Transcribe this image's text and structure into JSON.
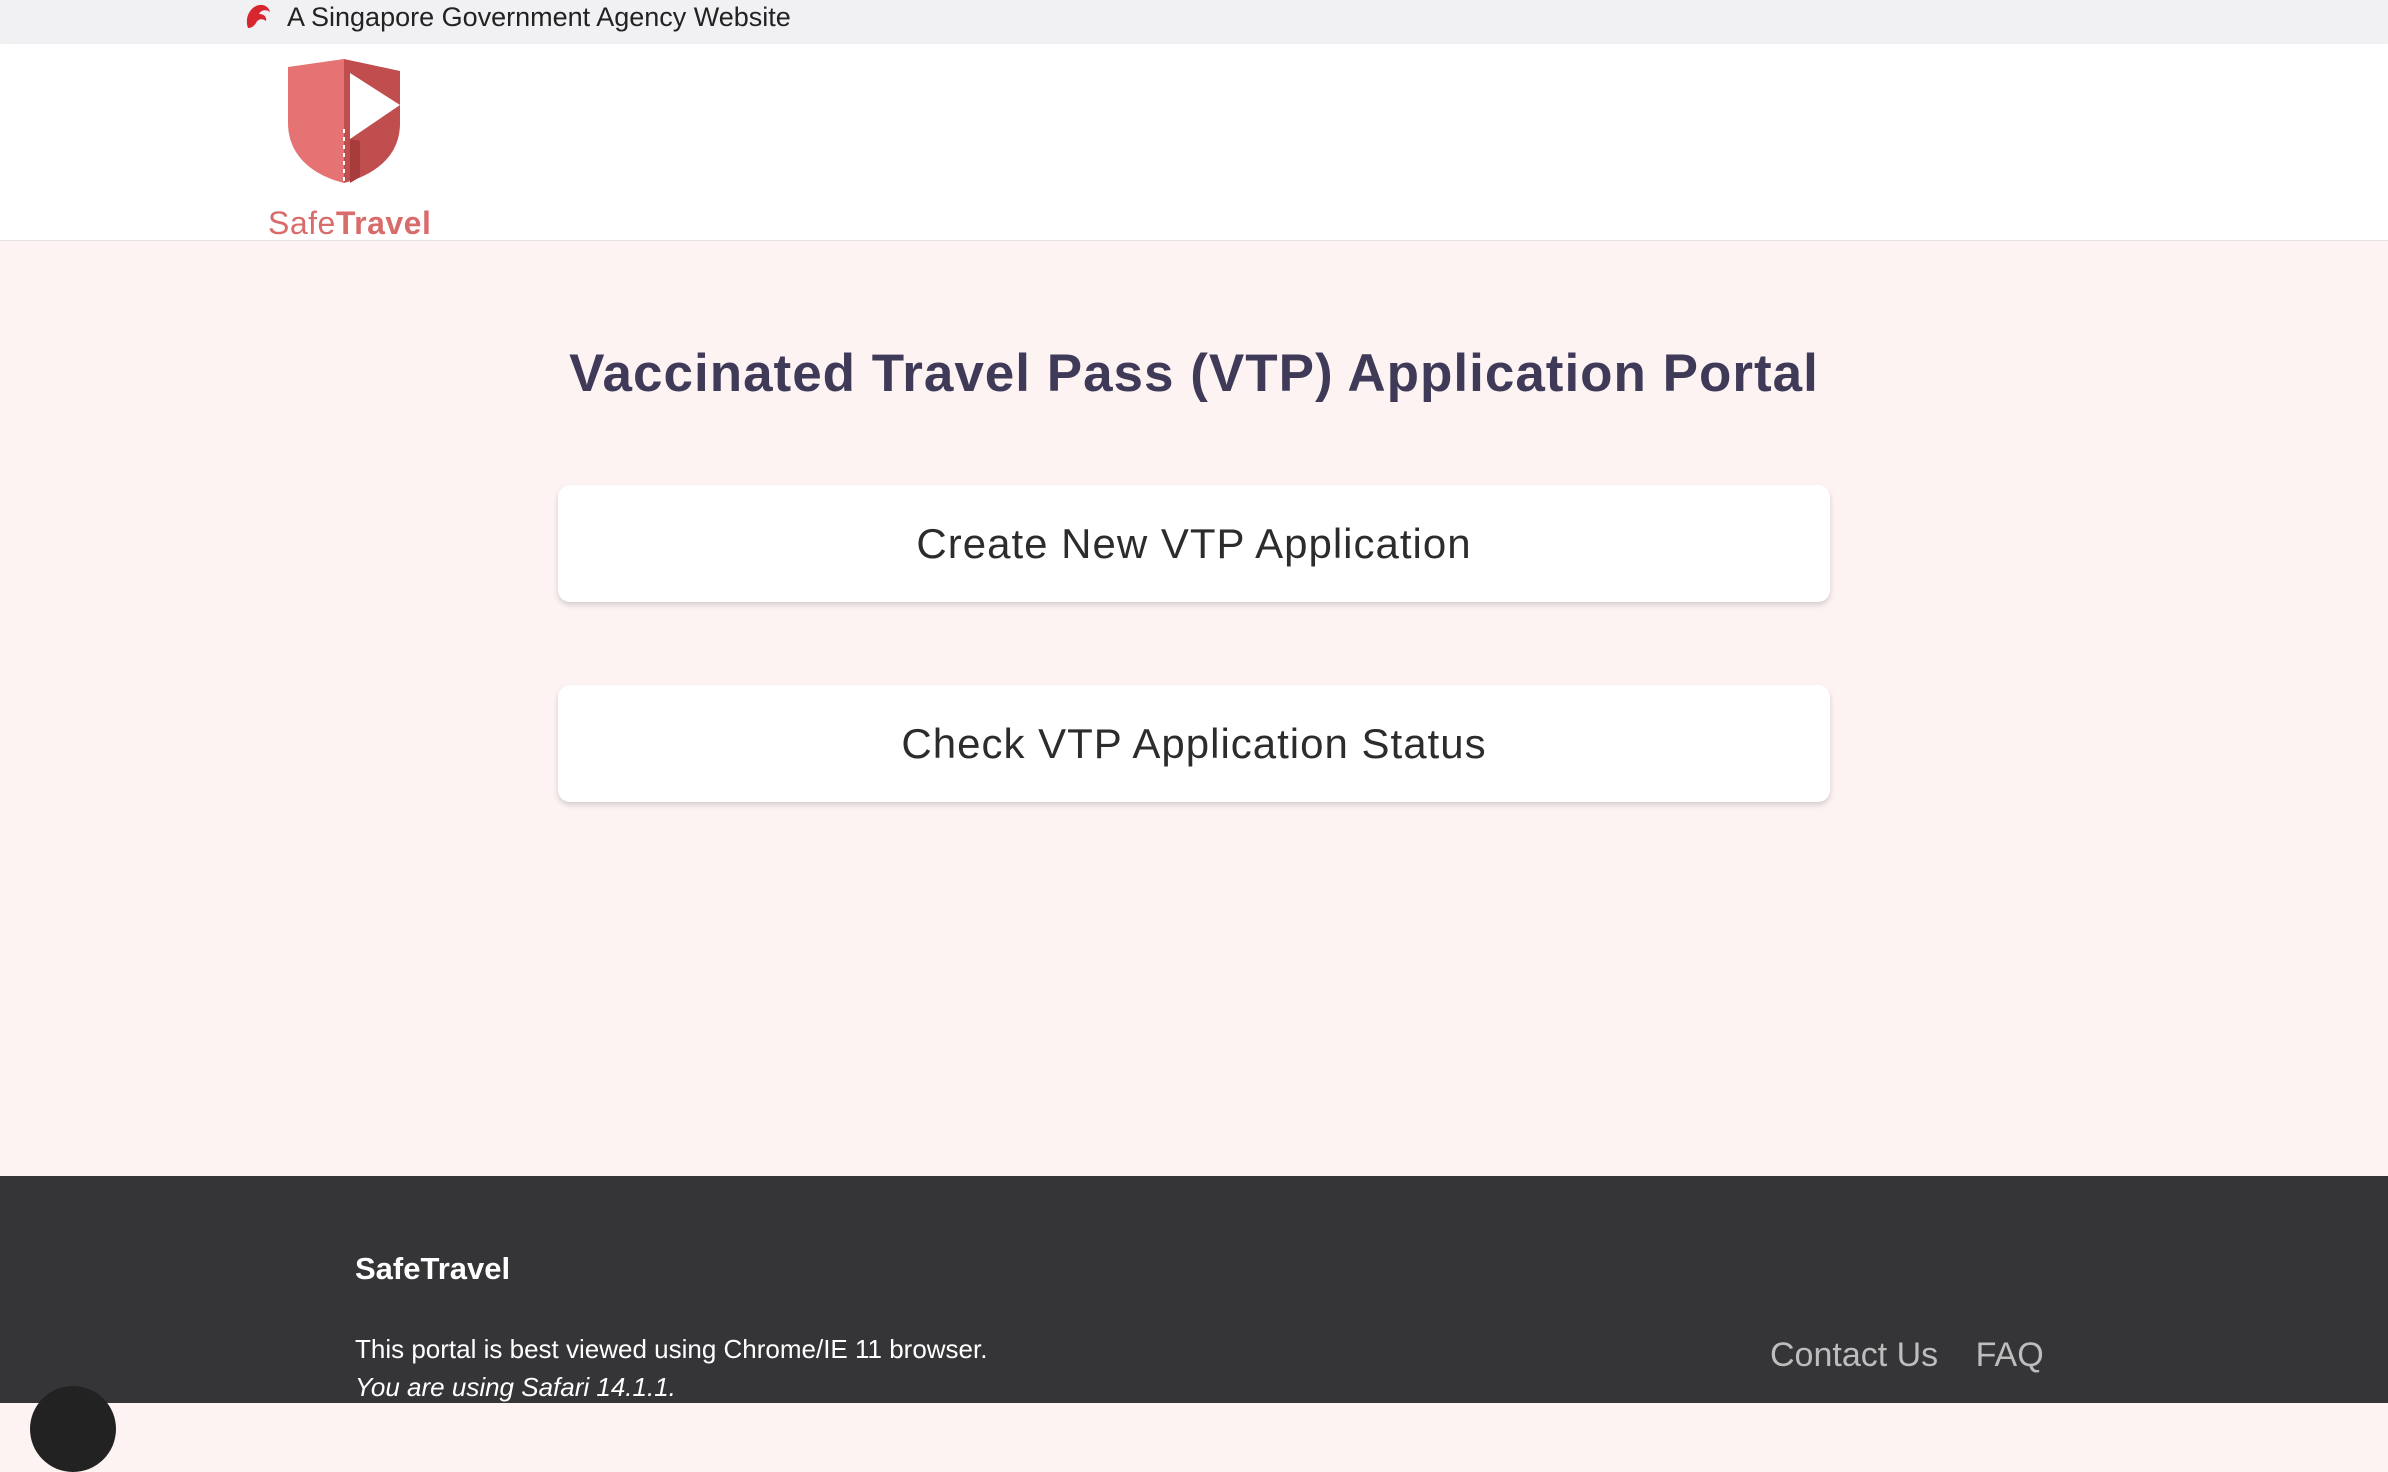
{
  "masthead": {
    "text": "A Singapore Government Agency Website",
    "icon": "lion-head-icon"
  },
  "logo": {
    "word_part1": "Safe",
    "word_part2": "Travel",
    "color": "#d96b6b"
  },
  "main": {
    "title": "Vaccinated Travel Pass (VTP) Application Portal",
    "create_button": "Create New VTP Application",
    "check_button": "Check VTP Application Status"
  },
  "footer": {
    "brand": "SafeTravel",
    "browser_note": "This portal is best viewed using Chrome/IE 11 browser.",
    "current_browser": "You are using Safari 14.1.1.",
    "links": [
      "Contact Us",
      "FAQ"
    ]
  },
  "colors": {
    "title": "#3f3a58",
    "page_background": "#fdf3f3",
    "footer_background": "#353437",
    "accent": "#e06c6c"
  }
}
